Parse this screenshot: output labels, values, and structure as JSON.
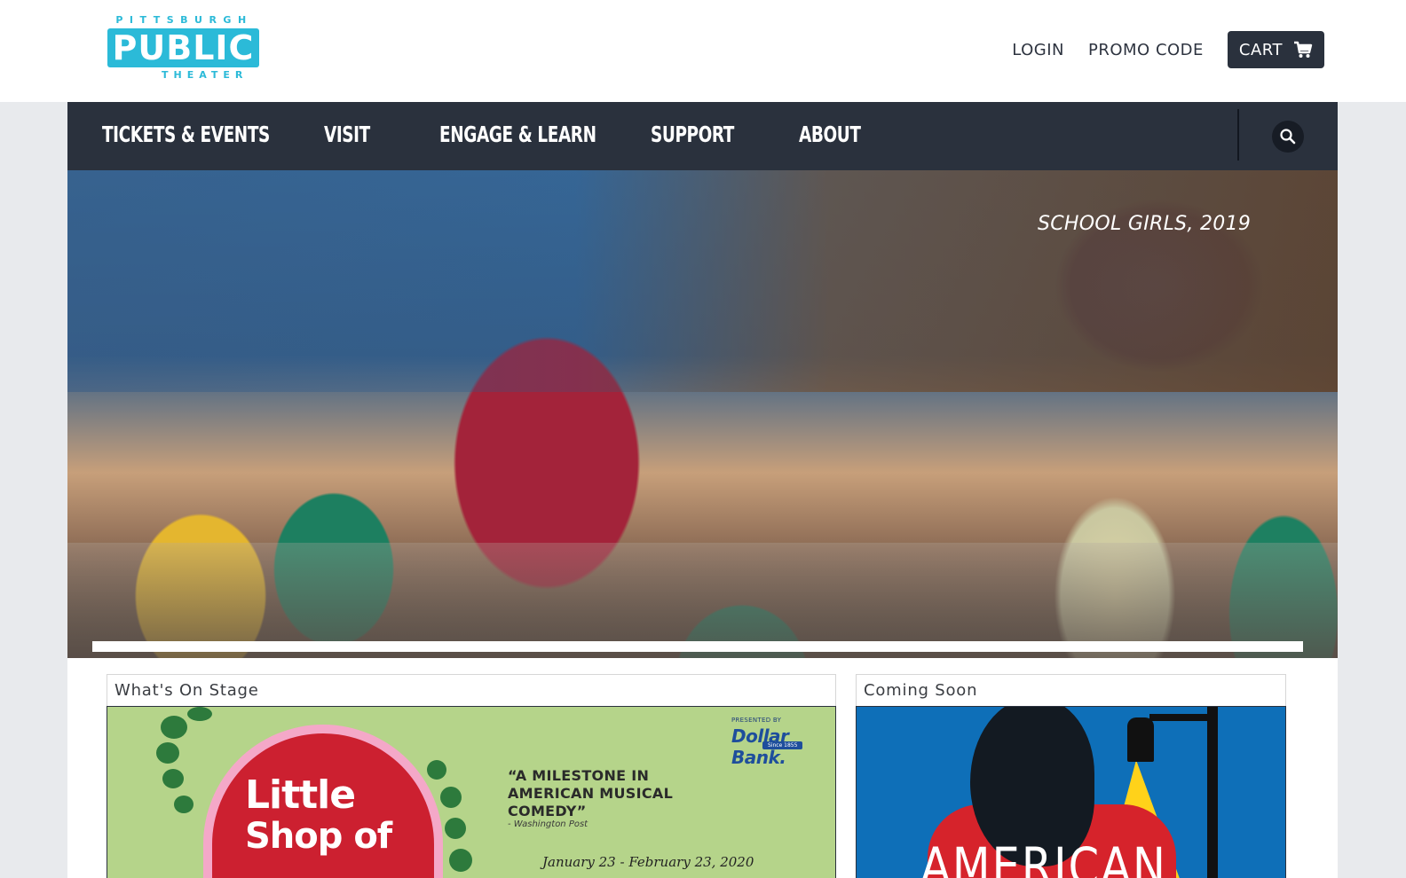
{
  "logo": {
    "top_text": "PITTSBURGH",
    "main_text": "PUBLIC",
    "bottom_text": "THEATER"
  },
  "top_links": {
    "login": "LOGIN",
    "promo": "PROMO CODE",
    "cart": "CART"
  },
  "nav": {
    "items": [
      {
        "label": "TICKETS & EVENTS"
      },
      {
        "label": "VISIT"
      },
      {
        "label": "ENGAGE & LEARN"
      },
      {
        "label": "SUPPORT"
      },
      {
        "label": "ABOUT"
      }
    ]
  },
  "hero": {
    "caption": "SCHOOL GIRLS, 2019"
  },
  "whats_on_stage": {
    "title": "What's On Stage",
    "show": {
      "title_line1": "Little",
      "title_line2": "Shop of",
      "sponsor_label": "PRESENTED BY",
      "sponsor_name": "Dollar Bank.",
      "sponsor_since": "Since 1855",
      "quote": "“A MILESTONE IN AMERICAN MUSICAL COMEDY”",
      "quote_source": "- Washington Post",
      "dates": "January 23 - February 23, 2020"
    }
  },
  "coming_soon": {
    "title": "Coming Soon",
    "show": {
      "title_partial": "AMERICAN"
    }
  },
  "colors": {
    "brand_cyan": "#2bbad8",
    "nav_dark": "#2a313d",
    "page_bg": "#e8eaed"
  },
  "icons": {
    "cart": "cart-icon",
    "search": "search-icon"
  }
}
